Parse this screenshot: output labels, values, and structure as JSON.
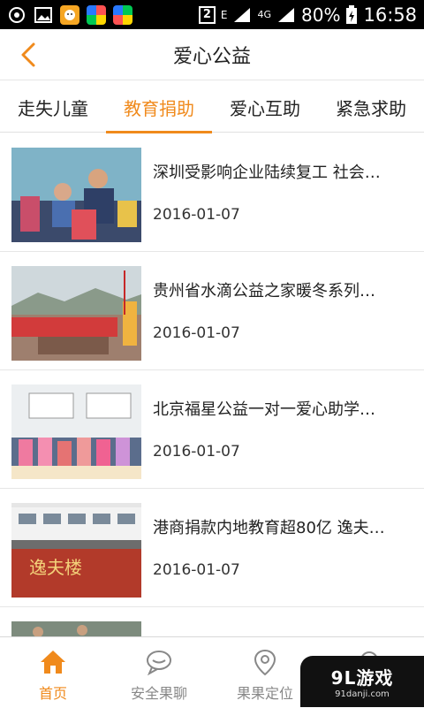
{
  "status": {
    "sim_slot": "2",
    "network_e": "E",
    "network_4g": "4G",
    "battery": "80%",
    "time": "16:58"
  },
  "header": {
    "title": "爱心公益",
    "back_icon": "chevron-left-icon"
  },
  "tabs": [
    {
      "label": "走失儿童"
    },
    {
      "label": "教育捐助"
    },
    {
      "label": "爱心互助"
    },
    {
      "label": "紧急求助"
    }
  ],
  "articles": [
    {
      "title": "深圳受影响企业陆续复工 社会…",
      "date": "2016-01-07"
    },
    {
      "title": "贵州省水滴公益之家暖冬系列…",
      "date": "2016-01-07"
    },
    {
      "title": "北京福星公益一对一爱心助学…",
      "date": "2016-01-07"
    },
    {
      "title": "港商捐款内地教育超80亿 逸夫…",
      "date": "2016-01-07"
    },
    {
      "title": "",
      "date": ""
    }
  ],
  "nav": [
    {
      "label": "首页",
      "icon": "home-icon"
    },
    {
      "label": "安全果聊",
      "icon": "chat-bubble-icon"
    },
    {
      "label": "果果定位",
      "icon": "location-pin-icon"
    },
    {
      "label": "",
      "icon": "search-icon"
    }
  ],
  "watermark": {
    "main": "9L游戏",
    "sub": "91danji.com"
  },
  "colors": {
    "accent": "#f08a1c",
    "text": "#222222",
    "muted": "#888888"
  }
}
